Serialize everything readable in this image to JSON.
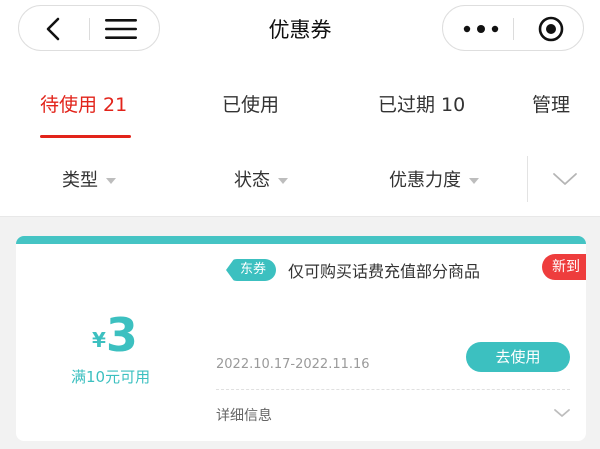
{
  "nav": {
    "title": "优惠券"
  },
  "tabs": [
    {
      "label": "待使用 21",
      "active": true
    },
    {
      "label": "已使用",
      "active": false
    },
    {
      "label": "已过期 10",
      "active": false
    },
    {
      "label": "管理",
      "active": false
    }
  ],
  "filters": [
    {
      "label": "类型"
    },
    {
      "label": "状态"
    },
    {
      "label": "优惠力度"
    }
  ],
  "coupon": {
    "currency": "¥",
    "amount": "3",
    "condition": "满10元可用",
    "tag": "东券",
    "description": "仅可购买话费充值部分商品",
    "badge": "新到",
    "validity": "2022.10.17-2022.11.16",
    "use_button": "去使用",
    "detail_label": "详细信息"
  },
  "colors": {
    "accent_red": "#e2231a",
    "coupon_teal": "#3cc0c0",
    "badge_red": "#ee3d3d"
  },
  "icons": {
    "back": "back-arrow-icon",
    "menu": "menu-icon",
    "more": "more-dots-icon",
    "close": "target-close-icon",
    "expand": "chevron-down-icon"
  }
}
